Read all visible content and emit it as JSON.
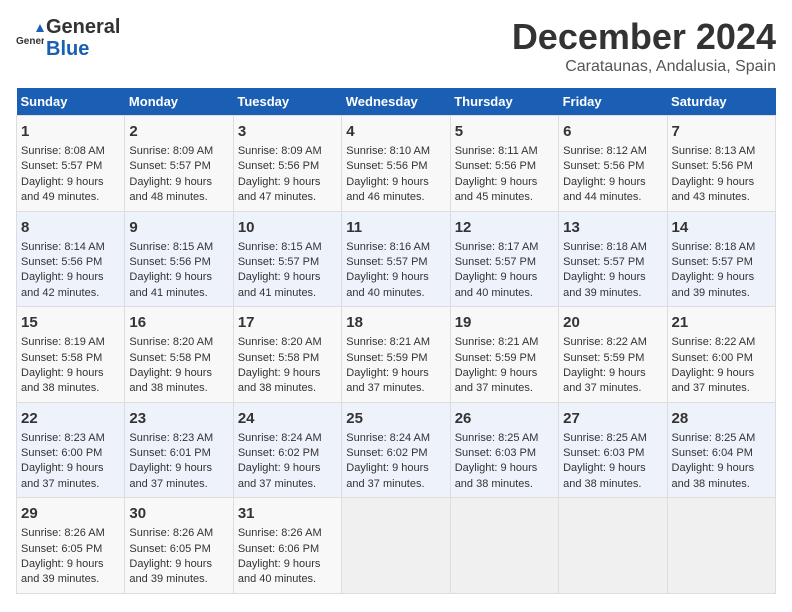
{
  "logo": {
    "line1": "General",
    "line2": "Blue"
  },
  "title": "December 2024",
  "subtitle": "Carataunas, Andalusia, Spain",
  "days_of_week": [
    "Sunday",
    "Monday",
    "Tuesday",
    "Wednesday",
    "Thursday",
    "Friday",
    "Saturday"
  ],
  "weeks": [
    [
      {
        "day": "1",
        "info": "Sunrise: 8:08 AM\nSunset: 5:57 PM\nDaylight: 9 hours\nand 49 minutes."
      },
      {
        "day": "2",
        "info": "Sunrise: 8:09 AM\nSunset: 5:57 PM\nDaylight: 9 hours\nand 48 minutes."
      },
      {
        "day": "3",
        "info": "Sunrise: 8:09 AM\nSunset: 5:56 PM\nDaylight: 9 hours\nand 47 minutes."
      },
      {
        "day": "4",
        "info": "Sunrise: 8:10 AM\nSunset: 5:56 PM\nDaylight: 9 hours\nand 46 minutes."
      },
      {
        "day": "5",
        "info": "Sunrise: 8:11 AM\nSunset: 5:56 PM\nDaylight: 9 hours\nand 45 minutes."
      },
      {
        "day": "6",
        "info": "Sunrise: 8:12 AM\nSunset: 5:56 PM\nDaylight: 9 hours\nand 44 minutes."
      },
      {
        "day": "7",
        "info": "Sunrise: 8:13 AM\nSunset: 5:56 PM\nDaylight: 9 hours\nand 43 minutes."
      }
    ],
    [
      {
        "day": "8",
        "info": "Sunrise: 8:14 AM\nSunset: 5:56 PM\nDaylight: 9 hours\nand 42 minutes."
      },
      {
        "day": "9",
        "info": "Sunrise: 8:15 AM\nSunset: 5:56 PM\nDaylight: 9 hours\nand 41 minutes."
      },
      {
        "day": "10",
        "info": "Sunrise: 8:15 AM\nSunset: 5:57 PM\nDaylight: 9 hours\nand 41 minutes."
      },
      {
        "day": "11",
        "info": "Sunrise: 8:16 AM\nSunset: 5:57 PM\nDaylight: 9 hours\nand 40 minutes."
      },
      {
        "day": "12",
        "info": "Sunrise: 8:17 AM\nSunset: 5:57 PM\nDaylight: 9 hours\nand 40 minutes."
      },
      {
        "day": "13",
        "info": "Sunrise: 8:18 AM\nSunset: 5:57 PM\nDaylight: 9 hours\nand 39 minutes."
      },
      {
        "day": "14",
        "info": "Sunrise: 8:18 AM\nSunset: 5:57 PM\nDaylight: 9 hours\nand 39 minutes."
      }
    ],
    [
      {
        "day": "15",
        "info": "Sunrise: 8:19 AM\nSunset: 5:58 PM\nDaylight: 9 hours\nand 38 minutes."
      },
      {
        "day": "16",
        "info": "Sunrise: 8:20 AM\nSunset: 5:58 PM\nDaylight: 9 hours\nand 38 minutes."
      },
      {
        "day": "17",
        "info": "Sunrise: 8:20 AM\nSunset: 5:58 PM\nDaylight: 9 hours\nand 38 minutes."
      },
      {
        "day": "18",
        "info": "Sunrise: 8:21 AM\nSunset: 5:59 PM\nDaylight: 9 hours\nand 37 minutes."
      },
      {
        "day": "19",
        "info": "Sunrise: 8:21 AM\nSunset: 5:59 PM\nDaylight: 9 hours\nand 37 minutes."
      },
      {
        "day": "20",
        "info": "Sunrise: 8:22 AM\nSunset: 5:59 PM\nDaylight: 9 hours\nand 37 minutes."
      },
      {
        "day": "21",
        "info": "Sunrise: 8:22 AM\nSunset: 6:00 PM\nDaylight: 9 hours\nand 37 minutes."
      }
    ],
    [
      {
        "day": "22",
        "info": "Sunrise: 8:23 AM\nSunset: 6:00 PM\nDaylight: 9 hours\nand 37 minutes."
      },
      {
        "day": "23",
        "info": "Sunrise: 8:23 AM\nSunset: 6:01 PM\nDaylight: 9 hours\nand 37 minutes."
      },
      {
        "day": "24",
        "info": "Sunrise: 8:24 AM\nSunset: 6:02 PM\nDaylight: 9 hours\nand 37 minutes."
      },
      {
        "day": "25",
        "info": "Sunrise: 8:24 AM\nSunset: 6:02 PM\nDaylight: 9 hours\nand 37 minutes."
      },
      {
        "day": "26",
        "info": "Sunrise: 8:25 AM\nSunset: 6:03 PM\nDaylight: 9 hours\nand 38 minutes."
      },
      {
        "day": "27",
        "info": "Sunrise: 8:25 AM\nSunset: 6:03 PM\nDaylight: 9 hours\nand 38 minutes."
      },
      {
        "day": "28",
        "info": "Sunrise: 8:25 AM\nSunset: 6:04 PM\nDaylight: 9 hours\nand 38 minutes."
      }
    ],
    [
      {
        "day": "29",
        "info": "Sunrise: 8:26 AM\nSunset: 6:05 PM\nDaylight: 9 hours\nand 39 minutes."
      },
      {
        "day": "30",
        "info": "Sunrise: 8:26 AM\nSunset: 6:05 PM\nDaylight: 9 hours\nand 39 minutes."
      },
      {
        "day": "31",
        "info": "Sunrise: 8:26 AM\nSunset: 6:06 PM\nDaylight: 9 hours\nand 40 minutes."
      },
      {
        "day": "",
        "info": ""
      },
      {
        "day": "",
        "info": ""
      },
      {
        "day": "",
        "info": ""
      },
      {
        "day": "",
        "info": ""
      }
    ]
  ]
}
